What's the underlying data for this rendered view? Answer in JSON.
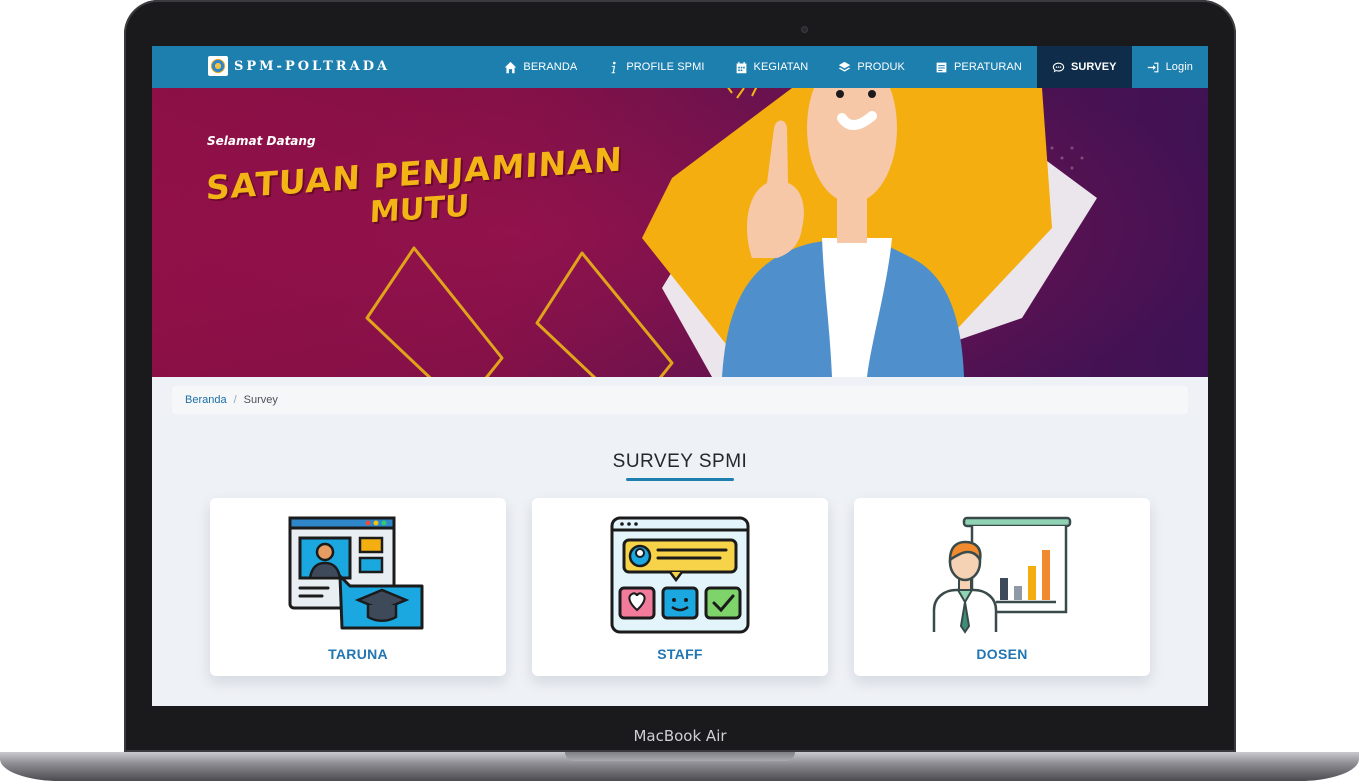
{
  "device": {
    "label": "MacBook Air"
  },
  "navbar": {
    "brand": "SPM-POLTRADA",
    "items": [
      {
        "label": "BERANDA",
        "icon": "home-icon"
      },
      {
        "label": "PROFILE SPMI",
        "icon": "info-icon"
      },
      {
        "label": "KEGIATAN",
        "icon": "calendar-icon"
      },
      {
        "label": "PRODUK",
        "icon": "layers-icon"
      },
      {
        "label": "PERATURAN",
        "icon": "document-icon"
      },
      {
        "label": "SURVEY",
        "icon": "chat-icon",
        "active": true
      },
      {
        "label": "Login",
        "icon": "login-icon"
      }
    ]
  },
  "hero": {
    "welcome": "Selamat Datang",
    "title_line1": "SATUAN PENJAMINAN",
    "title_line2": "MUTU"
  },
  "breadcrumb": {
    "home": "Beranda",
    "current": "Survey"
  },
  "section": {
    "title": "SURVEY SPMI"
  },
  "cards": [
    {
      "label": "TARUNA",
      "icon": "online-class-icon"
    },
    {
      "label": "STAFF",
      "icon": "feedback-icon"
    },
    {
      "label": "DOSEN",
      "icon": "presentation-icon"
    }
  ],
  "colors": {
    "navbar": "#1d7fae",
    "active_nav": "#0f2d4b",
    "accent_text": "#2277b3",
    "hero_gold": "#f3b515"
  }
}
